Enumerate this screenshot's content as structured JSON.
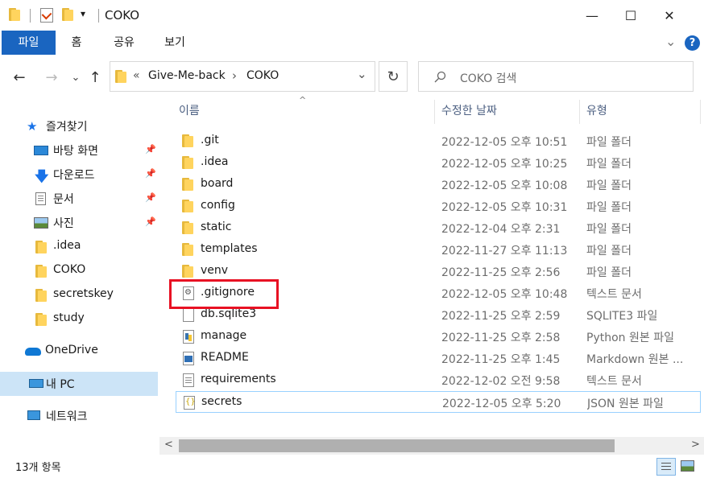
{
  "title": {
    "text": "COKO"
  },
  "window_controls": {
    "minimize": "—",
    "maximize": "☐",
    "close": "✕"
  },
  "ribbon": {
    "tabs": [
      "파일",
      "홈",
      "공유",
      "보기"
    ],
    "expand": "⌄",
    "help": "?"
  },
  "address": {
    "overflow": "«",
    "crumbs": [
      "Give-Me-back",
      "COKO"
    ],
    "chevron": "›",
    "dropdown": "⌄",
    "refresh": "↻"
  },
  "nav": {
    "back": "←",
    "forward": "→",
    "recent": "⌄",
    "up": "↑"
  },
  "search": {
    "placeholder": "COKO 검색",
    "icon": "search-icon"
  },
  "sidebar": {
    "quick_access": "즐겨찾기",
    "items": [
      {
        "label": "바탕 화면",
        "icon": "desktop-icon",
        "pinned": true
      },
      {
        "label": "다운로드",
        "icon": "download-icon",
        "pinned": true
      },
      {
        "label": "문서",
        "icon": "document-icon",
        "pinned": true
      },
      {
        "label": "사진",
        "icon": "picture-icon",
        "pinned": true
      },
      {
        "label": ".idea",
        "icon": "folder-icon",
        "pinned": false
      },
      {
        "label": "COKO",
        "icon": "folder-icon",
        "pinned": false
      },
      {
        "label": "secretskey",
        "icon": "folder-icon",
        "pinned": false
      },
      {
        "label": "study",
        "icon": "folder-icon",
        "pinned": false
      }
    ],
    "onedrive": "OneDrive",
    "this_pc": "내 PC",
    "network": "네트워크"
  },
  "columns": {
    "name": "이름",
    "date": "수정한 날짜",
    "type": "유형",
    "sort_indicator": "^"
  },
  "files": [
    {
      "name": ".git",
      "date": "2022-12-05 오후 10:51",
      "type": "파일 폴더",
      "icon": "folder-icon"
    },
    {
      "name": ".idea",
      "date": "2022-12-05 오후 10:25",
      "type": "파일 폴더",
      "icon": "folder-icon"
    },
    {
      "name": "board",
      "date": "2022-12-05 오후 10:08",
      "type": "파일 폴더",
      "icon": "folder-icon"
    },
    {
      "name": "config",
      "date": "2022-12-05 오후 10:31",
      "type": "파일 폴더",
      "icon": "folder-icon"
    },
    {
      "name": "static",
      "date": "2022-12-04 오후 2:31",
      "type": "파일 폴더",
      "icon": "folder-icon"
    },
    {
      "name": "templates",
      "date": "2022-11-27 오후 11:13",
      "type": "파일 폴더",
      "icon": "folder-icon"
    },
    {
      "name": "venv",
      "date": "2022-11-25 오후 2:56",
      "type": "파일 폴더",
      "icon": "folder-icon"
    },
    {
      "name": ".gitignore",
      "date": "2022-12-05 오후 10:48",
      "type": "텍스트 문서",
      "icon": "settings-file-icon"
    },
    {
      "name": "db.sqlite3",
      "date": "2022-11-25 오후 2:59",
      "type": "SQLITE3 파일",
      "icon": "blank-file-icon"
    },
    {
      "name": "manage",
      "date": "2022-11-25 오후 2:58",
      "type": "Python 원본 파일",
      "icon": "python-file-icon"
    },
    {
      "name": "README",
      "date": "2022-11-25 오후 1:45",
      "type": "Markdown 원본 ...",
      "icon": "markdown-file-icon"
    },
    {
      "name": "requirements",
      "date": "2022-12-02 오전 9:58",
      "type": "텍스트 문서",
      "icon": "text-file-icon"
    },
    {
      "name": "secrets",
      "date": "2022-12-05 오후 5:20",
      "type": "JSON 원본 파일",
      "icon": "json-file-icon"
    }
  ],
  "scroll": {
    "left": "<",
    "right": ">"
  },
  "status": {
    "count": "13개 항목"
  },
  "colors": {
    "accent": "#1a65c0",
    "highlight_box": "#e81123",
    "selection_border": "#99d1ff",
    "folder": "#ffd45e"
  }
}
